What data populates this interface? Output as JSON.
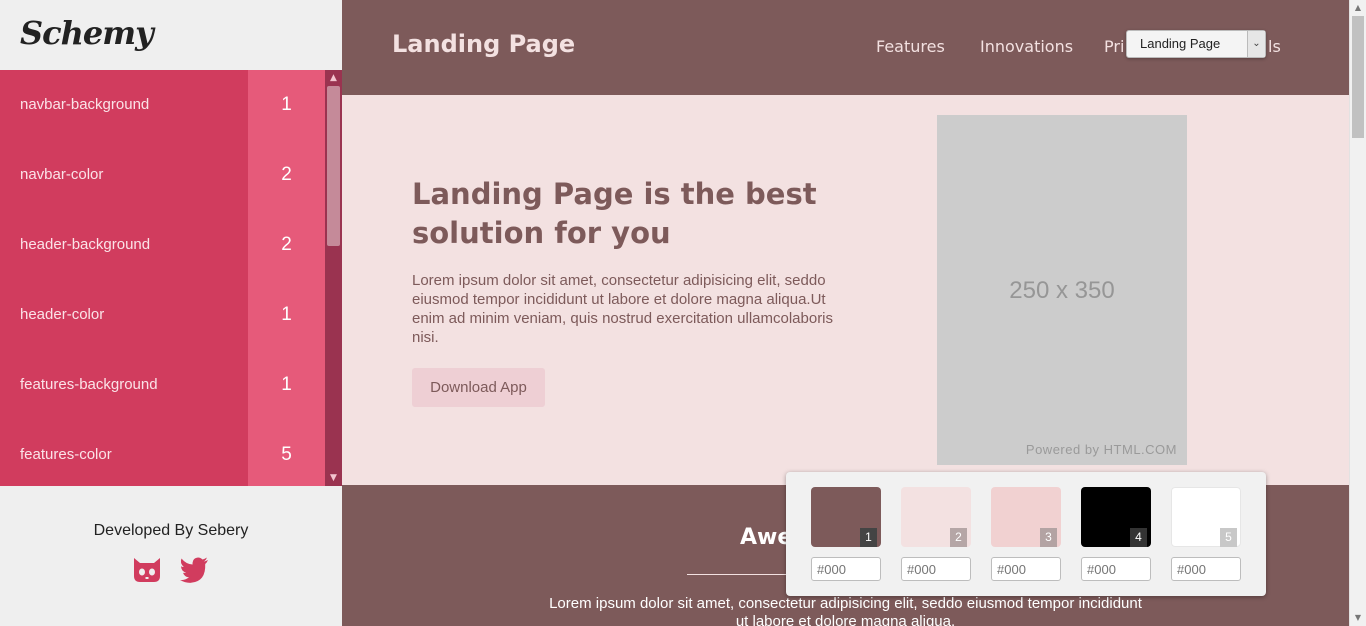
{
  "sidebar": {
    "logo": "Schemy",
    "variables": [
      {
        "name": "navbar-background",
        "value": "1"
      },
      {
        "name": "navbar-color",
        "value": "2"
      },
      {
        "name": "header-background",
        "value": "2"
      },
      {
        "name": "header-color",
        "value": "1"
      },
      {
        "name": "features-background",
        "value": "1"
      },
      {
        "name": "features-color",
        "value": "5"
      }
    ],
    "developed_by": "Developed By Sebery",
    "social": [
      {
        "icon": "github-icon"
      },
      {
        "icon": "twitter-icon"
      }
    ]
  },
  "preview": {
    "brand": "Landing Page",
    "nav_links": [
      "Features",
      "Innovations",
      "Pri",
      "ls"
    ],
    "select": {
      "value": "Landing Page"
    },
    "hero": {
      "title": "Landing Page is the best solution for you",
      "text": "Lorem ipsum dolor sit amet, consectetur adipisicing elit, seddo eiusmod tempor incididunt ut labore et dolore magna aliqua.Ut enim ad minim veniam, quis nostrud exercitation ullamcolaboris nisi.",
      "button": "Download App"
    },
    "placeholder": {
      "size_label": "250 x 350",
      "credit": "Powered by HTML.COM"
    },
    "features": {
      "title": "Awe",
      "text": "Lorem ipsum dolor sit amet, consectetur adipisicing elit, seddo eiusmod tempor incididunt ut labore et dolore magna aliqua."
    }
  },
  "palette": {
    "colors": [
      {
        "index": "1",
        "hex": "#7d5a5a",
        "badge_bg": "#444444"
      },
      {
        "index": "2",
        "hex": "#f3e1e1",
        "badge_bg": "#b5a6a6"
      },
      {
        "index": "3",
        "hex": "#f1d1d1",
        "badge_bg": "#b3a3a3"
      },
      {
        "index": "4",
        "hex": "#000000",
        "badge_bg": "#333333"
      },
      {
        "index": "5",
        "hex": "#ffffff",
        "badge_bg": "#c8c8c8"
      }
    ],
    "input_placeholder": "#000"
  }
}
